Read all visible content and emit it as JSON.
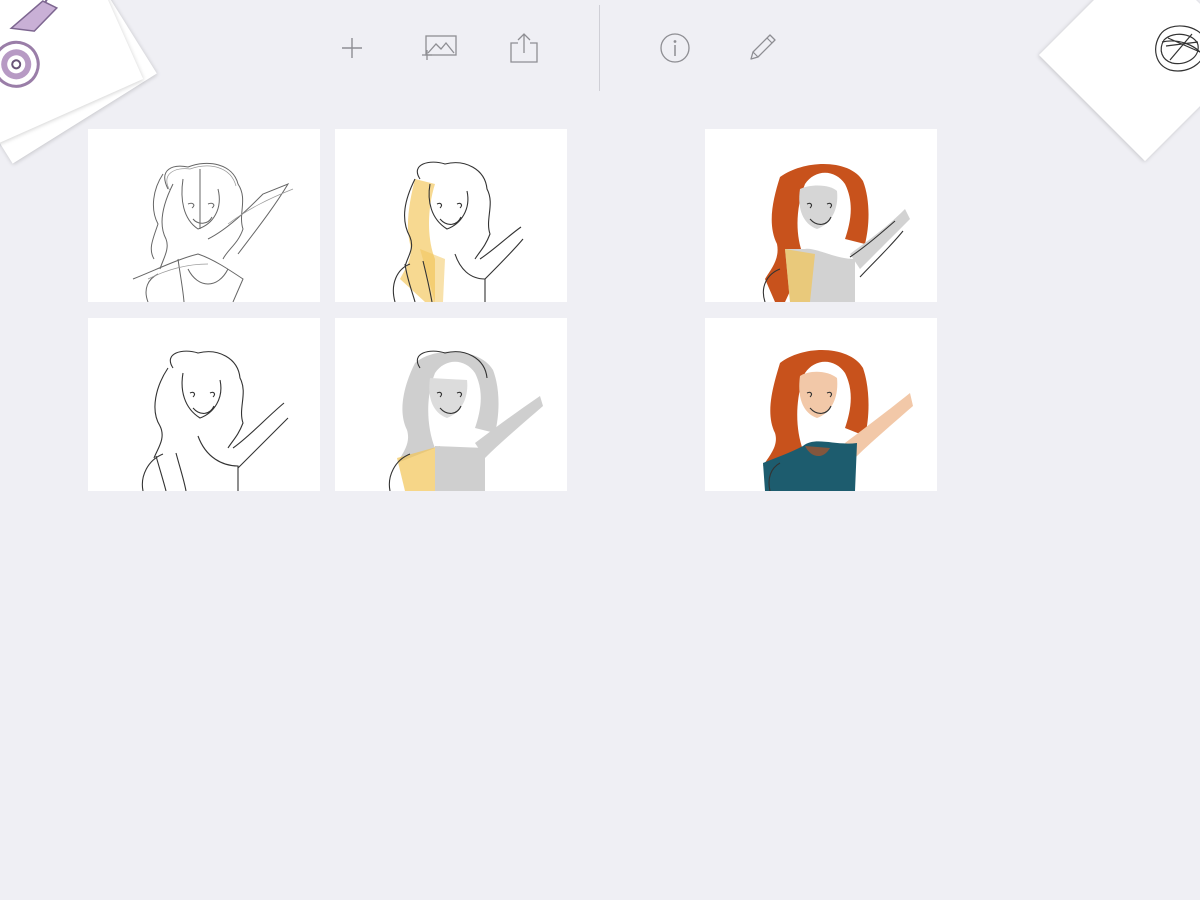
{
  "toolbar": {
    "buttons": [
      {
        "icon": "plus-icon"
      },
      {
        "icon": "add-image-icon"
      },
      {
        "icon": "share-icon"
      },
      {
        "icon": "info-icon"
      },
      {
        "icon": "pencil-icon"
      }
    ]
  },
  "corners": {
    "left": {
      "icon": "sketch-thumbnail-icon"
    },
    "right": {
      "icon": "sketch-thumbnail-icon"
    }
  },
  "gallery": {
    "pages": [
      {
        "stage": "rough-sketch"
      },
      {
        "stage": "line-art"
      },
      {
        "stage": "yellow-shading"
      },
      {
        "stage": "gray-and-yellow-shading"
      },
      {
        "stage": "hair-colored"
      },
      {
        "stage": "fully-colored"
      }
    ]
  },
  "colors": {
    "background": "#efeff4",
    "icon": "#8e8e93",
    "hair": "#c8521c",
    "skin": "#f2c8a8",
    "shirt": "#1d5c6e",
    "yellow": "#f2c456",
    "gray": "#c8c8c8"
  }
}
